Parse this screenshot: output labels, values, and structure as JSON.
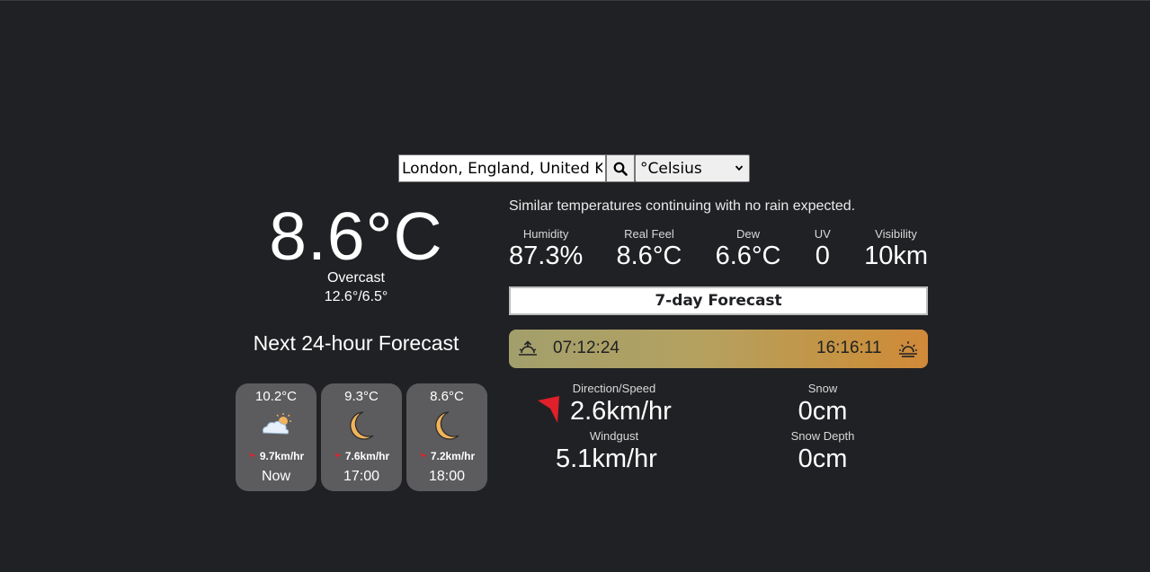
{
  "search": {
    "value": "London, England, United K",
    "button": "search-icon"
  },
  "unit_select": {
    "selected": "°Celsius"
  },
  "current": {
    "temperature": "8.6°C",
    "condition": "Overcast",
    "high_low": "12.6°/6.5°"
  },
  "summary": "Similar temperatures continuing with no rain expected.",
  "stats": [
    {
      "label": "Humidity",
      "value": "87.3%"
    },
    {
      "label": "Real Feel",
      "value": "8.6°C"
    },
    {
      "label": "Dew",
      "value": "6.6°C"
    },
    {
      "label": "UV",
      "value": "0"
    },
    {
      "label": "Visibility",
      "value": "10km"
    }
  ],
  "forecast_button": "7-day Forecast",
  "sun": {
    "sunrise": "07:12:24",
    "sunset": "16:16:11"
  },
  "hourly": {
    "title": "Next 24-hour Forecast",
    "items": [
      {
        "temp": "10.2°C",
        "icon": "partly-cloudy-icon",
        "wind": "9.7km/hr",
        "time": "Now"
      },
      {
        "temp": "9.3°C",
        "icon": "moon-icon",
        "wind": "7.6km/hr",
        "time": "17:00"
      },
      {
        "temp": "8.6°C",
        "icon": "moon-icon",
        "wind": "7.2km/hr",
        "time": "18:00"
      }
    ]
  },
  "wind": {
    "direction_label": "Direction/Speed",
    "speed": "2.6km/hr",
    "gust_label": "Windgust",
    "gust": "5.1km/hr"
  },
  "snow": {
    "snow_label": "Snow",
    "snow": "0cm",
    "depth_label": "Snow Depth",
    "depth": "0cm"
  },
  "colors": {
    "background": "#202124",
    "card": "#5c5c5e",
    "wind_arrow": "#e0202a",
    "moon": "#f2b35a"
  }
}
